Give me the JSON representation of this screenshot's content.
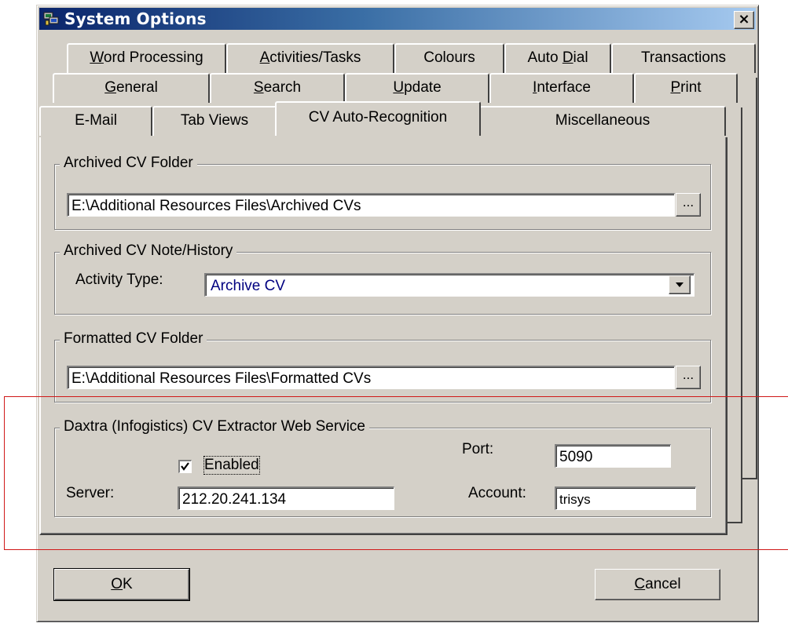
{
  "window": {
    "title": "System Options",
    "close_label": "×"
  },
  "tabs": {
    "row1": [
      {
        "label": "Word Processing",
        "accel": "W",
        "rest": "ord Processing"
      },
      {
        "label": "Activities/Tasks",
        "accel": "A",
        "rest": "ctivities/Tasks"
      },
      {
        "label": "Colours",
        "accel": "",
        "rest": "Colours"
      },
      {
        "label": "Auto Dial",
        "accel_pre": "Auto ",
        "accel": "D",
        "rest": "ial"
      },
      {
        "label": "Transactions",
        "accel": "",
        "rest": "Transactions"
      }
    ],
    "row2": [
      {
        "label": "General",
        "accel": "G",
        "rest": "eneral"
      },
      {
        "label": "Search",
        "accel": "S",
        "rest": "earch"
      },
      {
        "label": "Update",
        "accel": "U",
        "rest": "pdate"
      },
      {
        "label": "Interface",
        "accel": "I",
        "rest": "nterface"
      },
      {
        "label": "Print",
        "accel": "P",
        "rest": "rint"
      }
    ],
    "row3": [
      {
        "label": "E-Mail"
      },
      {
        "label": "Tab Views"
      },
      {
        "label": "CV Auto-Recognition"
      },
      {
        "label": "Miscellaneous"
      }
    ],
    "active": "CV Auto-Recognition"
  },
  "archived_folder": {
    "legend": "Archived CV Folder",
    "path": "E:\\Additional Resources Files\\Archived CVs",
    "browse": "..."
  },
  "archived_note": {
    "legend": "Archived CV Note/History",
    "activity_label": "Activity Type:",
    "activity_value": "Archive CV"
  },
  "formatted_folder": {
    "legend": "Formatted CV Folder",
    "path": "E:\\Additional Resources Files\\Formatted CVs",
    "browse": "..."
  },
  "daxtra": {
    "legend": "Daxtra (Infogistics) CV Extractor Web Service",
    "enabled_label": "Enabled",
    "enabled_checked": true,
    "port_label": "Port:",
    "port_value": "5090",
    "server_label": "Server:",
    "server_value": "212.20.241.134",
    "account_label": "Account:",
    "account_value": "trisys"
  },
  "buttons": {
    "ok": "OK",
    "cancel": "Cancel"
  },
  "colors": {
    "title_bar_start": "#0a246a",
    "title_bar_end": "#a6caf0",
    "dialog_face": "#d4d0c8",
    "highlight_frame": "#d01818",
    "dropdown_text": "#000080"
  }
}
